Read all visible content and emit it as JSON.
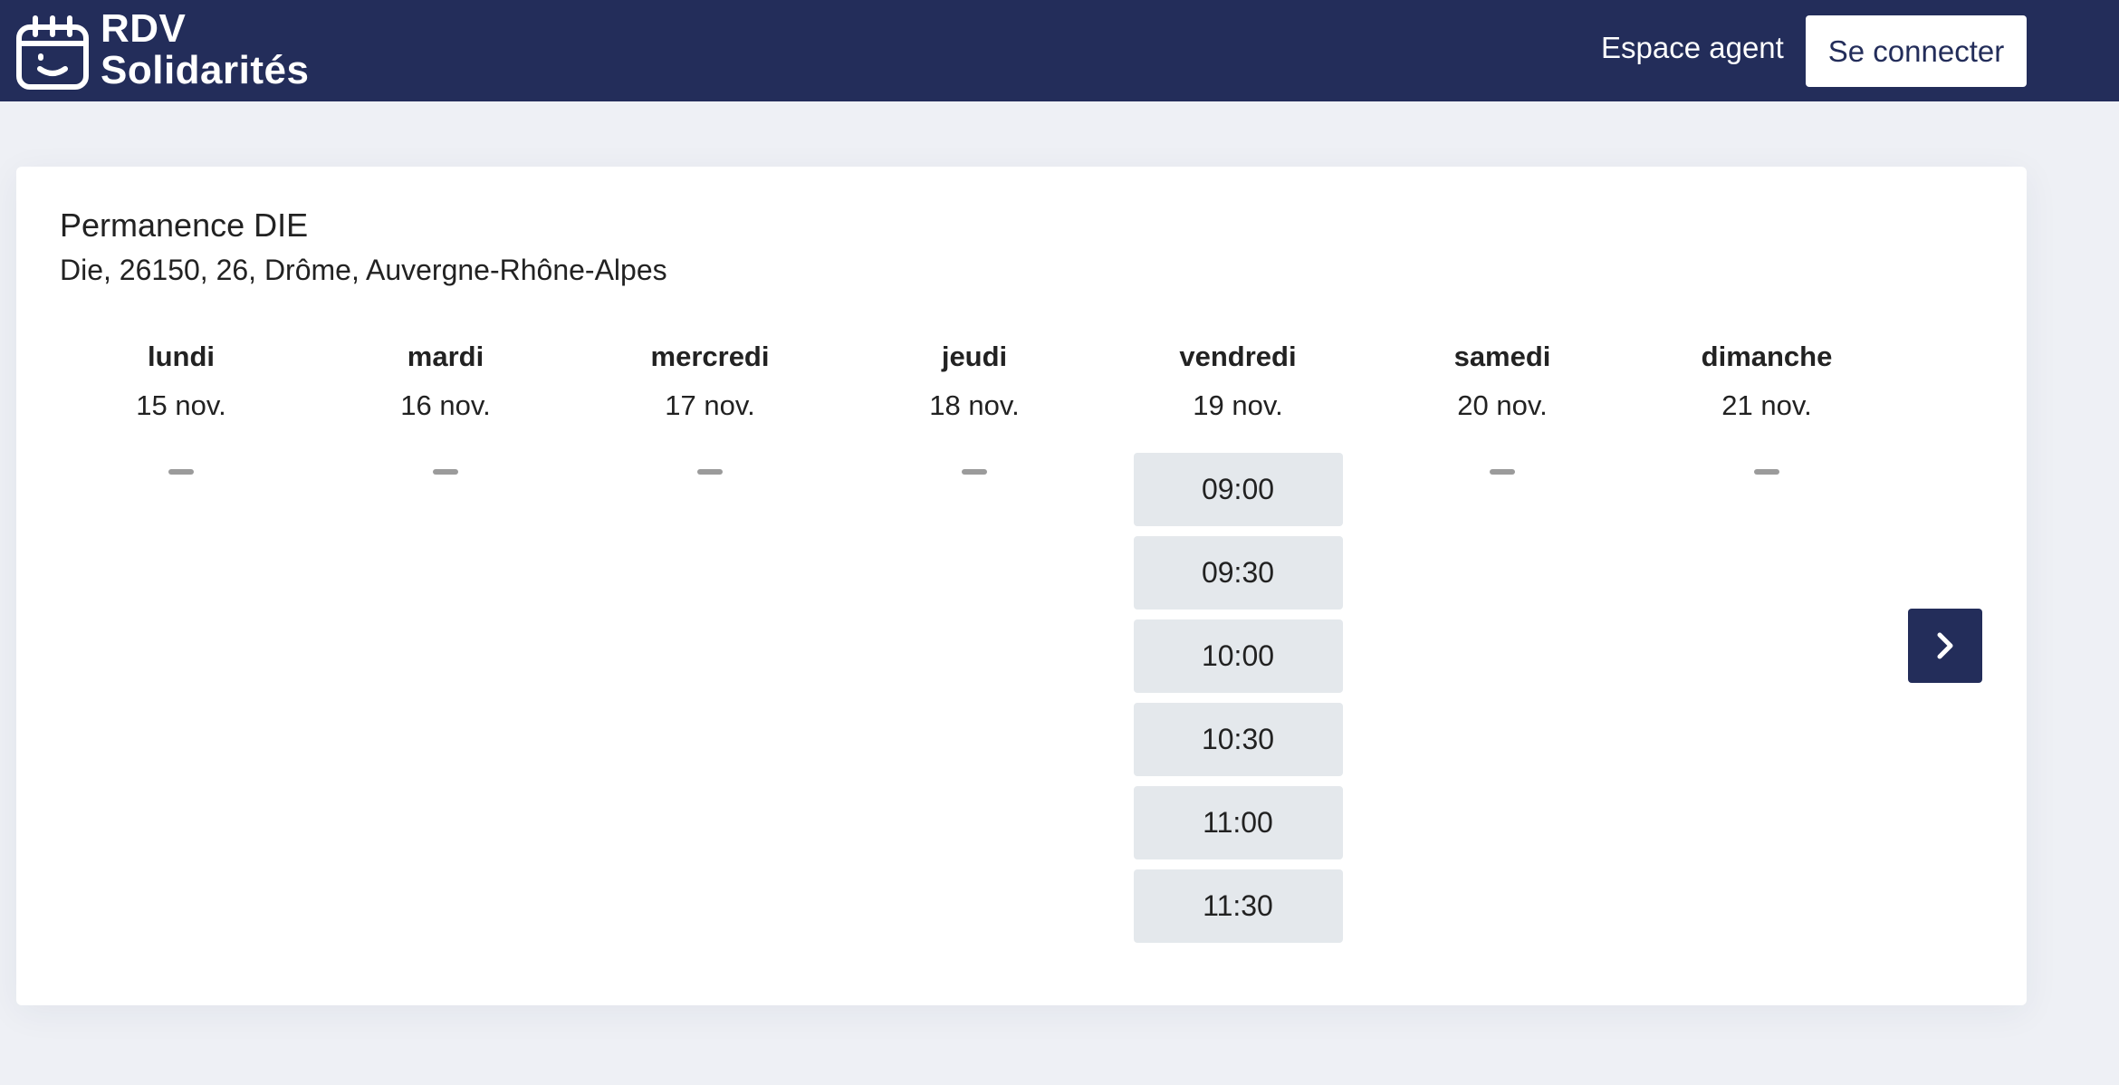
{
  "header": {
    "brand_line1": "RDV",
    "brand_line2": "Solidarités",
    "agent_link": "Espace agent",
    "login_button": "Se connecter",
    "background_color": "#232d5a"
  },
  "place": {
    "title": "Permanence DIE",
    "address": "Die, 26150, 26, Drôme, Auvergne-Rhône-Alpes"
  },
  "week": {
    "days": [
      {
        "name": "lundi",
        "date": "15 nov.",
        "slots": []
      },
      {
        "name": "mardi",
        "date": "16 nov.",
        "slots": []
      },
      {
        "name": "mercredi",
        "date": "17 nov.",
        "slots": []
      },
      {
        "name": "jeudi",
        "date": "18 nov.",
        "slots": []
      },
      {
        "name": "vendredi",
        "date": "19 nov.",
        "slots": [
          "09:00",
          "09:30",
          "10:00",
          "10:30",
          "11:00",
          "11:30"
        ]
      },
      {
        "name": "samedi",
        "date": "20 nov.",
        "slots": []
      },
      {
        "name": "dimanche",
        "date": "21 nov.",
        "slots": []
      }
    ],
    "next_icon": "chevron-right-icon",
    "empty_day_icon": "dash-icon"
  },
  "colors": {
    "primary": "#232d5a",
    "page_background": "#eef0f5",
    "slot_background": "#e4e8ec"
  }
}
